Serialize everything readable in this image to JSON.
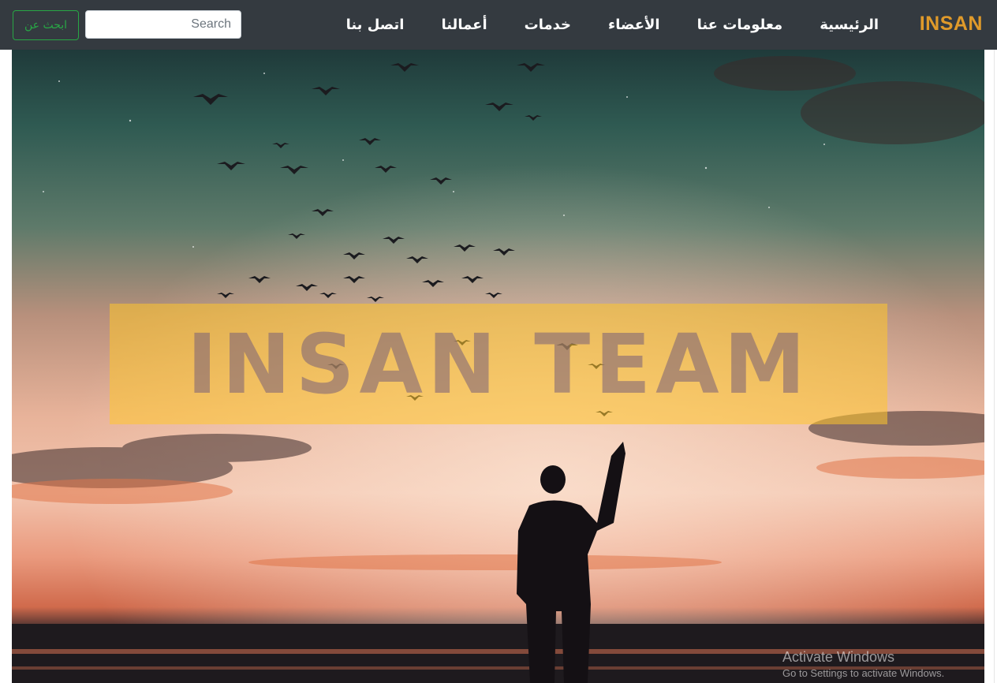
{
  "navbar": {
    "brand": "INSAN",
    "links": [
      "الرئيسية",
      "معلومات عنا",
      "الأعضاء",
      "خدمات",
      "أعمالنا",
      "اتصل بنا"
    ],
    "search_placeholder": "Search",
    "search_button": "ابحث عن"
  },
  "hero": {
    "banner_text": "INSAN TEAM"
  },
  "watermark": {
    "title": "Activate Windows",
    "subtitle": "Go to Settings to activate Windows."
  },
  "colors": {
    "navbar_bg": "#343a40",
    "brand": "#e09a2a",
    "search_button": "#28a745",
    "banner": "#ffc72c"
  }
}
